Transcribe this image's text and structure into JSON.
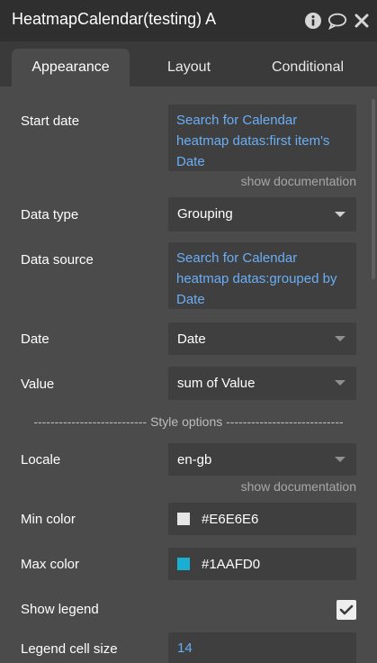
{
  "window": {
    "title": "HeatmapCalendar(testing) A"
  },
  "icons": {
    "info": "info-icon",
    "comment": "comment-icon",
    "close": "close-icon"
  },
  "tabs": [
    {
      "label": "Appearance",
      "active": true
    },
    {
      "label": "Layout",
      "active": false
    },
    {
      "label": "Conditional",
      "active": false
    }
  ],
  "fields": {
    "start_date": {
      "label": "Start date",
      "value": "Search for Calendar heatmap datas:first item's Date",
      "doc": "show documentation"
    },
    "data_type": {
      "label": "Data type",
      "value": "Grouping"
    },
    "data_source": {
      "label": "Data source",
      "value": "Search for Calendar heatmap datas:grouped by Date"
    },
    "date": {
      "label": "Date",
      "value": "Date"
    },
    "value": {
      "label": "Value",
      "value": "sum of Value"
    },
    "style_options": {
      "label": "--------------------------- Style options ----------------------------"
    },
    "locale": {
      "label": "Locale",
      "value": "en-gb",
      "doc": "show documentation"
    },
    "min_color": {
      "label": "Min color",
      "value": "#E6E6E6",
      "swatch": "#E6E6E6"
    },
    "max_color": {
      "label": "Max color",
      "value": "#1AAFD0",
      "swatch": "#1AAFD0"
    },
    "show_legend": {
      "label": "Show legend",
      "checked": true
    },
    "legend_cell_size": {
      "label": "Legend cell size",
      "value": "14"
    }
  },
  "colors": {
    "dynamic_text": "#6aaef5",
    "panel": "#4b4b4b",
    "field": "#3f3f3f",
    "titlebar": "#2f2f2f"
  }
}
